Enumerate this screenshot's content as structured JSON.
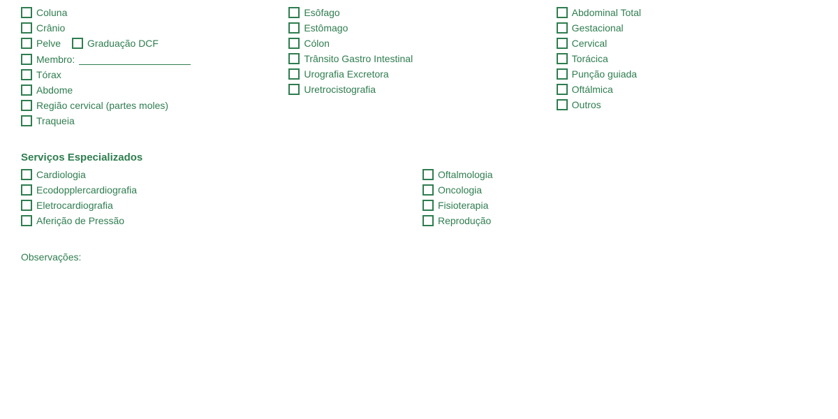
{
  "col1": {
    "items": [
      {
        "label": "Coluna"
      },
      {
        "label": "Crânio"
      },
      {
        "label": "Pelve"
      },
      {
        "label": "Graduação DCF"
      },
      {
        "label": "Membro:"
      },
      {
        "label": "Tórax"
      },
      {
        "label": "Abdome"
      },
      {
        "label": "Região cervical (partes moles)"
      },
      {
        "label": "Traqueia"
      }
    ]
  },
  "col2": {
    "items": [
      {
        "label": "Esôfago"
      },
      {
        "label": "Estômago"
      },
      {
        "label": "Cólon"
      },
      {
        "label": "Trânsito Gastro Intestinal"
      },
      {
        "label": "Urografia Excretora"
      },
      {
        "label": "Uretrocistografia"
      }
    ]
  },
  "col3": {
    "items": [
      {
        "label": "Abdominal Total"
      },
      {
        "label": "Gestacional"
      },
      {
        "label": "Cervical"
      },
      {
        "label": "Torácica"
      },
      {
        "label": "Punção guiada"
      },
      {
        "label": "Oftálmica"
      },
      {
        "label": "Outros"
      }
    ]
  },
  "services": {
    "title": "Serviços Especializados",
    "col1": [
      {
        "label": "Cardiologia"
      },
      {
        "label": "Ecodopplercardiografia"
      },
      {
        "label": "Eletrocardiografia"
      },
      {
        "label": "Aferição de Pressão"
      }
    ],
    "col2": [
      {
        "label": "Oftalmologia"
      },
      {
        "label": "Oncologia"
      },
      {
        "label": "Fisioterapia"
      },
      {
        "label": "Reprodução"
      }
    ]
  },
  "observations": {
    "label": "Observações:"
  }
}
